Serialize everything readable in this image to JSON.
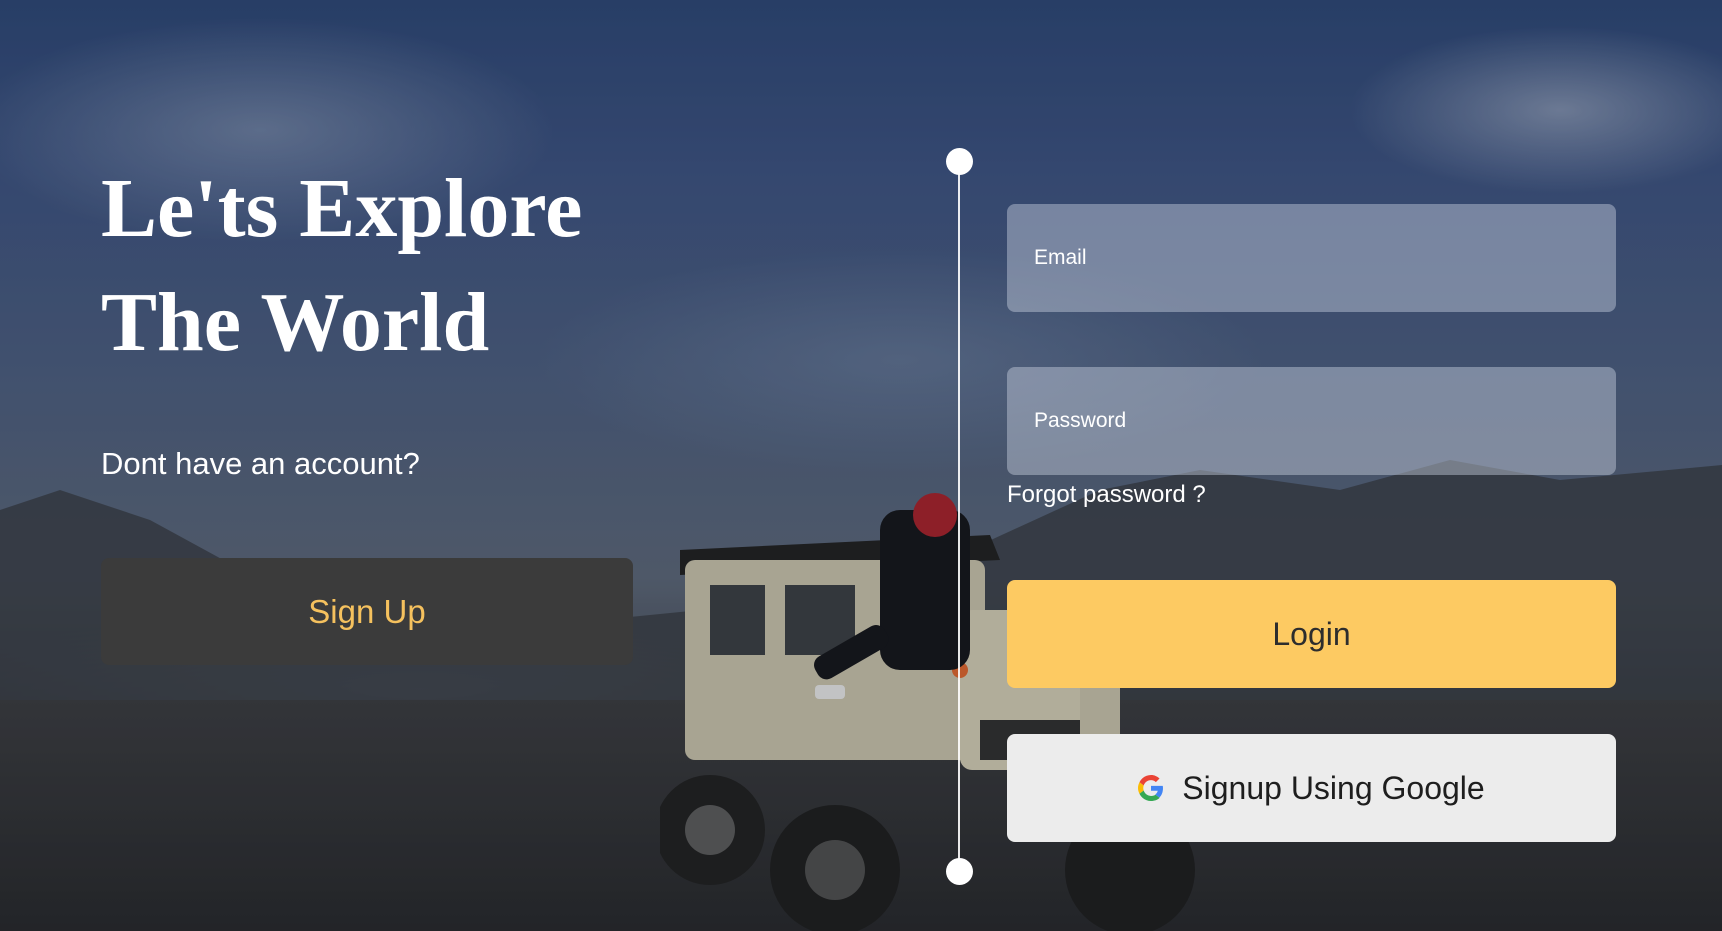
{
  "hero": {
    "line1": "Le'ts Explore",
    "line2": "The World",
    "no_account": "Dont have an account?",
    "signup_label": "Sign Up"
  },
  "form": {
    "email_placeholder": "Email",
    "password_placeholder": "Password",
    "forgot_label": "Forgot password ?",
    "login_label": "Login",
    "google_label": "Signup Using Google"
  },
  "icons": {
    "google": "google-icon"
  },
  "colors": {
    "accent": "#fdca62",
    "signup_text": "#f5c15e",
    "dark_button": "#3b3b3b",
    "google_button": "#ececec"
  }
}
